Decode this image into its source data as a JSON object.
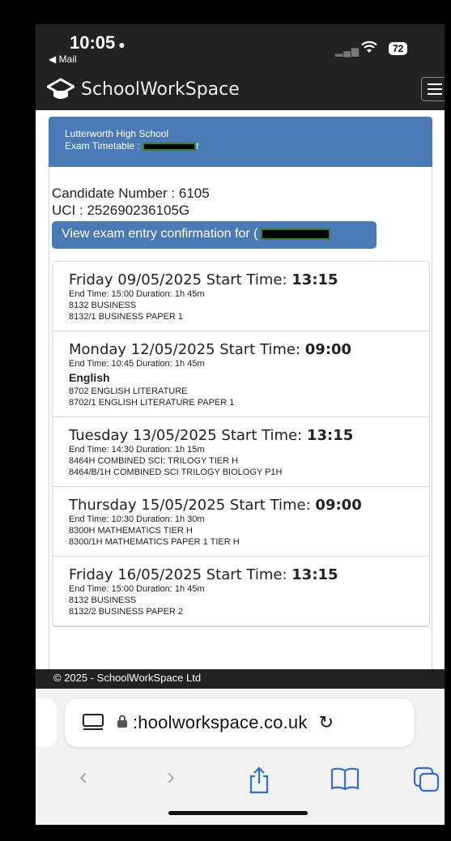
{
  "status_bar": {
    "time": "10:05",
    "back_label": "◀ Mail",
    "battery": "72"
  },
  "nav": {
    "brand": "SchoolWorkSpace"
  },
  "panel": {
    "school": "Lutterworth High School",
    "timetable_label": "Exam Timetable :",
    "timetable_suffix": "t"
  },
  "candidate": {
    "number_label": "Candidate Number : 6105",
    "uci_label": "UCI : 252690236105G"
  },
  "confirm_button": "View exam entry confirmation for (",
  "exams": [
    {
      "date": "Friday 09/05/2025 Start Time: ",
      "start": "13:15",
      "end_duration": "End Time: 15:00 Duration: 1h 45m",
      "subject": "",
      "code": "8132 BUSINESS",
      "paper": "8132/1 BUSINESS PAPER 1"
    },
    {
      "date": "Monday 12/05/2025 Start Time: ",
      "start": "09:00",
      "end_duration": "End Time: 10:45 Duration: 1h 45m",
      "subject": "English",
      "code": "8702 ENGLISH LITERATURE",
      "paper": "8702/1 ENGLISH LITERATURE PAPER 1"
    },
    {
      "date": "Tuesday 13/05/2025 Start Time: ",
      "start": "13:15",
      "end_duration": "End Time: 14:30 Duration: 1h 15m",
      "subject": "",
      "code": "8464H COMBINED SCI: TRILOGY TIER H",
      "paper": "8464/B/1H COMBINED SCI TRILOGY BIOLOGY P1H"
    },
    {
      "date": "Thursday 15/05/2025 Start Time: ",
      "start": "09:00",
      "end_duration": "End Time: 10:30 Duration: 1h 30m",
      "subject": "",
      "code": "8300H MATHEMATICS TIER H",
      "paper": "8300/1H MATHEMATICS PAPER 1 TIER H"
    },
    {
      "date": "Friday 16/05/2025 Start Time: ",
      "start": "13:15",
      "end_duration": "End Time: 15:00 Duration: 1h 45m",
      "subject": "",
      "code": "8132 BUSINESS",
      "paper": "8132/2 BUSINESS PAPER 2"
    }
  ],
  "footer": "© 2025 - SchoolWorkSpace Ltd",
  "safari": {
    "domain": ":hoolworkspace.co.uk"
  },
  "colors": {
    "accent": "#4a7ab6",
    "dark_bar": "#222222",
    "link_blue": "#2f6dd9"
  }
}
